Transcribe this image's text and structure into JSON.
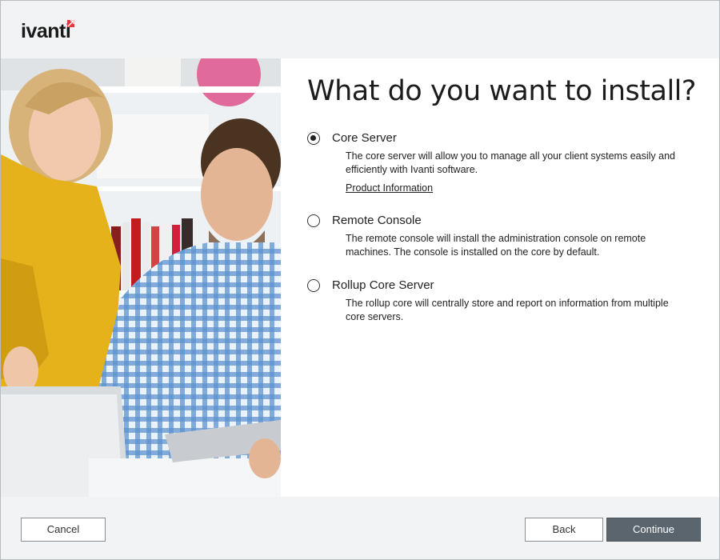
{
  "brand": {
    "name": "ivanti",
    "accent": "#e03a3e"
  },
  "page": {
    "title": "What do you want to install?"
  },
  "options": [
    {
      "label": "Core Server",
      "description": "The core server will allow you to manage all your client systems easily and efficiently with Ivanti software.",
      "link": "Product Information",
      "selected": true
    },
    {
      "label": "Remote Console",
      "description": "The remote console will install the administration console on remote machines. The console is installed on the core by default.",
      "selected": false
    },
    {
      "label": "Rollup Core Server",
      "description": "The rollup core will centrally store and report on information from multiple core servers.",
      "selected": false
    }
  ],
  "footer": {
    "cancel_label": "Cancel",
    "back_label": "Back",
    "continue_label": "Continue"
  }
}
